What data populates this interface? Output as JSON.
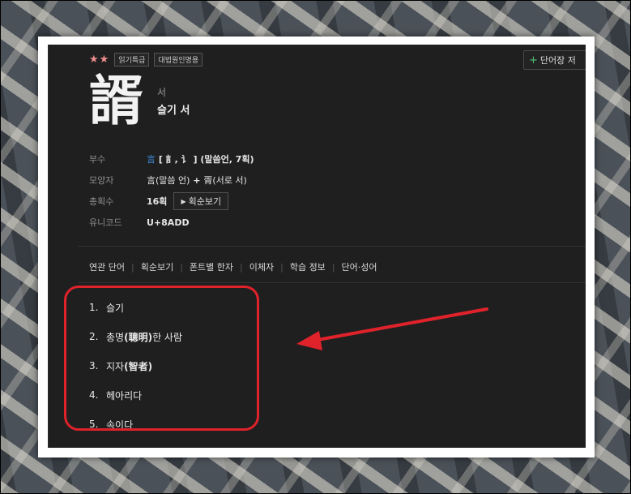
{
  "word": {
    "stars": "★★",
    "tags": [
      "읽기특급",
      "대법원인명용"
    ],
    "save_label": "단어장 저",
    "character": "諝",
    "reading": "서",
    "meaning": "슬기 서"
  },
  "info": {
    "radical_label": "부수",
    "radical_char": "言",
    "radical_detail": " [ 訁, 讠 ] (말씀언, 7획)",
    "shape_label": "모양자",
    "shape_a": "言",
    "shape_a_note": "(말씀 언)",
    "shape_plus": " + ",
    "shape_b": "胥",
    "shape_b_note": "(서로 서)",
    "strokes_label": "총획수",
    "strokes_value": "16획",
    "strokes_button": "획순보기",
    "unicode_label": "유니코드",
    "unicode_value": "U+8ADD"
  },
  "tabs": [
    "연관 단어",
    "획순보기",
    "폰트별 한자",
    "이체자",
    "학습 정보",
    "단어·성어"
  ],
  "definitions": [
    {
      "num": "1.",
      "text": "슬기"
    },
    {
      "num": "2.",
      "pre": "총명",
      "bold": "(聰明)",
      "post": "한 사람"
    },
    {
      "num": "3.",
      "pre": "지자",
      "bold": "(智者)",
      "post": ""
    },
    {
      "num": "4.",
      "text": "헤아리다"
    },
    {
      "num": "5.",
      "text": "속이다"
    }
  ],
  "annotation_color": "#e0222a"
}
